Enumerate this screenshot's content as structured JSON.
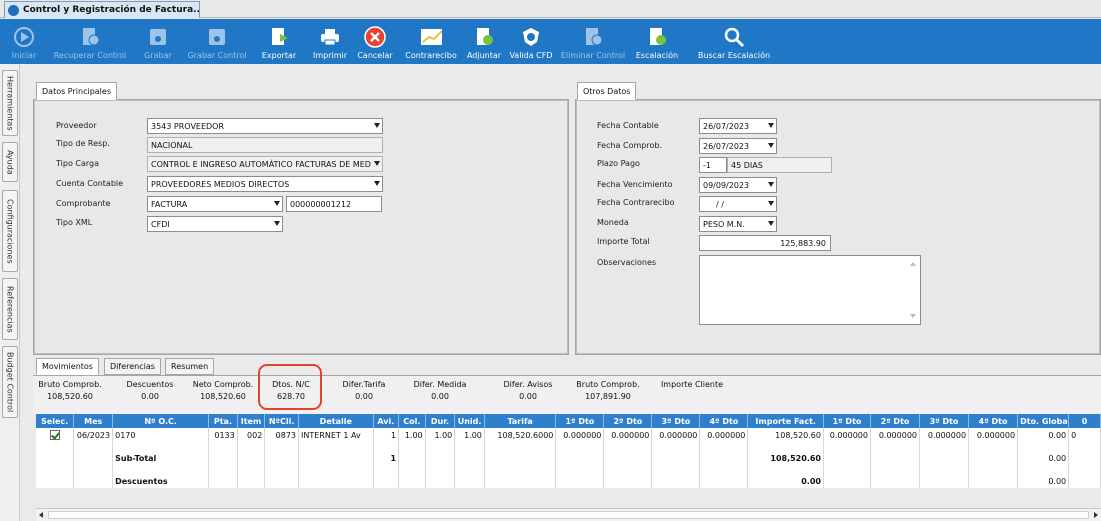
{
  "window": {
    "tab_title": "Control y Registración de Factura..."
  },
  "toolbar": {
    "items": [
      {
        "label": "Iniciar",
        "icon": "play-icon",
        "enabled": false
      },
      {
        "label": "Recuperar Control",
        "icon": "document-recover-icon",
        "enabled": false
      },
      {
        "label": "Grabar",
        "icon": "save-disk-icon",
        "enabled": false
      },
      {
        "label": "Grabar Control",
        "icon": "save-disk-icon",
        "enabled": false
      },
      {
        "label": "Exportar",
        "icon": "export-document-icon",
        "enabled": true
      },
      {
        "label": "Imprimir",
        "icon": "printer-icon",
        "enabled": true
      },
      {
        "label": "Cancelar",
        "icon": "cancel-x-icon",
        "enabled": true
      },
      {
        "label": "Contrarecibo",
        "icon": "chart-line-icon",
        "enabled": true
      },
      {
        "label": "Adjuntar",
        "icon": "attach-document-icon",
        "enabled": true
      },
      {
        "label": "Valida CFD",
        "icon": "shield-check-icon",
        "enabled": true
      },
      {
        "label": "Eliminar Control",
        "icon": "document-delete-icon",
        "enabled": false
      },
      {
        "label": "Escalación",
        "icon": "document-question-icon",
        "enabled": true
      },
      {
        "label": "Buscar Escalación",
        "icon": "search-icon",
        "enabled": true
      }
    ],
    "colors": {
      "background": "#1f77c5",
      "enabled_text": "#ffffff",
      "disabled_text": "#9dc3e8"
    }
  },
  "sidebar": {
    "tabs": [
      "Herramientas",
      "Ayuda",
      "Configuraciones",
      "Referencias",
      "Budget Control"
    ]
  },
  "datos_principales": {
    "tab": "Datos Principales",
    "proveedor": {
      "label": "Proveedor",
      "value": "3543 PROVEEDOR"
    },
    "tipo_resp": {
      "label": "Tipo de Resp.",
      "value": "NACIONAL"
    },
    "tipo_carga": {
      "label": "Tipo Carga",
      "value": "CONTROL E INGRESO AUTOMÁTICO FACTURAS DE MED"
    },
    "cuenta_contable": {
      "label": "Cuenta Contable",
      "value": "PROVEEDORES MEDIOS DIRECTOS"
    },
    "comprobante": {
      "label": "Comprobante",
      "value": "FACTURA",
      "number": "000000001212"
    },
    "tipo_xml": {
      "label": "Tipo XML",
      "value": "CFDI"
    }
  },
  "otros_datos": {
    "tab": "Otros Datos",
    "fecha_contable": {
      "label": "Fecha Contable",
      "value": "26/07/2023"
    },
    "fecha_comprob": {
      "label": "Fecha Comprob.",
      "value": "26/07/2023"
    },
    "plazo_pago": {
      "label": "Plazo Pago",
      "value": "-1",
      "desc": "45 DIAS"
    },
    "fecha_vencimiento": {
      "label": "Fecha Vencimiento",
      "value": "09/09/2023"
    },
    "fecha_contrarecibo": {
      "label": "Fecha Contrarecibo",
      "value": "/ /"
    },
    "moneda": {
      "label": "Moneda",
      "value": "PESO M.N."
    },
    "importe_total": {
      "label": "Importe Total",
      "value": "125,883.90"
    },
    "observaciones": {
      "label": "Observaciones",
      "value": ""
    }
  },
  "bottom_tabs": [
    "Movimientos",
    "Diferencias",
    "Resumen"
  ],
  "summary": [
    {
      "label": "Bruto Comprob.",
      "value": "108,520.60"
    },
    {
      "label": "Descuentos",
      "value": "0.00"
    },
    {
      "label": "Neto Comprob.",
      "value": "108,520.60"
    },
    {
      "label": "Dtos. N/C",
      "value": "628.70"
    },
    {
      "label": "Difer.Tarifa",
      "value": "0.00"
    },
    {
      "label": "Difer. Medida",
      "value": "0.00"
    },
    {
      "label": "Difer. Avisos",
      "value": "0.00"
    },
    {
      "label": "Bruto Comprob.",
      "value": "107,891.90"
    },
    {
      "label": "Importe Cliente",
      "value": ""
    }
  ],
  "grid": {
    "columns": [
      "Selec.",
      "Mes",
      "Nº O.C.",
      "Pta.",
      "Item",
      "NºCli.",
      "Detalle",
      "Avi.",
      "Col.",
      "Dur.",
      "Unid.",
      "Tarifa",
      "1º Dto",
      "2º Dto",
      "3º Dto",
      "4º Dto",
      "Importe Fact.",
      "1º Dto",
      "2º Dto",
      "3º Dto",
      "4º Dto",
      "Dto. Global",
      "0"
    ],
    "row": {
      "mes": "06/2023",
      "oc": "0170",
      "pta": "0133",
      "item": "002",
      "cli": "0873",
      "detalle": "INTERNET 1 Av",
      "avi": "1",
      "col": "1.00",
      "dur": "1.00",
      "unid": "1.00",
      "tarifa": "108,520.6000",
      "d1": "0.000000",
      "d2": "0.000000",
      "d3": "0.000000",
      "d4": "0.000000",
      "importe": "108,520.60",
      "e1": "0.000000",
      "e2": "0.000000",
      "e3": "0.000000",
      "e4": "0.000000",
      "global": "0.00",
      "last": "0"
    },
    "subtotal": {
      "label": "Sub-Total",
      "avi": "1",
      "importe": "108,520.60",
      "global": "0.00"
    },
    "descuentos": {
      "label": "Descuentos",
      "importe": "0.00",
      "global": "0.00"
    }
  }
}
